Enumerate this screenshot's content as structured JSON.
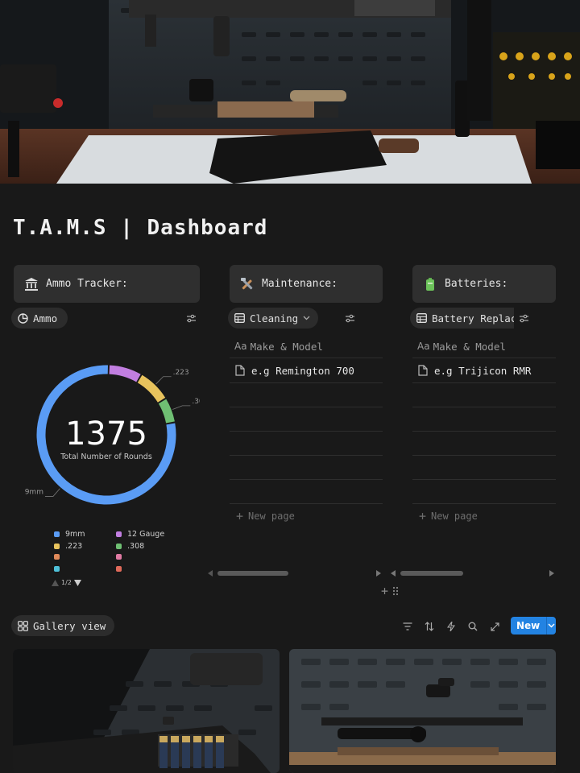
{
  "page": {
    "title": "T.A.M.S | Dashboard"
  },
  "callouts": {
    "ammo": "Ammo Tracker:",
    "maintenance": "Maintenance:",
    "batteries": "Batteries:"
  },
  "views": {
    "ammo_tab": "Ammo",
    "cleaning_tab": "Cleaning",
    "battery_tab": "Battery Replacement",
    "gallery_tab": "Gallery view"
  },
  "maintenance_table": {
    "column": "Make & Model",
    "rows": [
      "e.g Remington 700"
    ],
    "new_page": "New page"
  },
  "battery_table": {
    "column": "Make & Model",
    "rows": [
      "e.g Trijicon RMR"
    ],
    "new_page": "New page"
  },
  "chart_data": {
    "type": "pie",
    "total": "1375",
    "total_label": "Total Number of Rounds",
    "slice_labels": [
      ".308",
      ".223",
      "9mm"
    ],
    "series": [
      {
        "name": "9mm",
        "value": 1000,
        "color": "#5a9cf5"
      },
      {
        "name": "12 Gauge",
        "value": 100,
        "color": "#c17ee0"
      },
      {
        "name": ".223",
        "value": 100,
        "color": "#e8c35d"
      },
      {
        "name": ".308",
        "value": 75,
        "color": "#6fbf73"
      }
    ],
    "legend": {
      "items": [
        {
          "name": "9mm",
          "color": "#5a9cf5"
        },
        {
          "name": "12 Gauge",
          "color": "#c17ee0"
        },
        {
          "name": ".223",
          "color": "#e8c35d"
        },
        {
          "name": ".308",
          "color": "#6fbf73"
        },
        {
          "name": "",
          "color": "#e08a5a"
        },
        {
          "name": "",
          "color": "#e07aa3"
        },
        {
          "name": "",
          "color": "#4ec0d8"
        },
        {
          "name": "",
          "color": "#e06a5a"
        }
      ],
      "page": "1/2"
    }
  },
  "toolbar": {
    "new_label": "New"
  },
  "icons": {
    "ammo_callout": "bank-icon",
    "maintenance_callout": "tools-icon",
    "batteries_callout": "battery-icon"
  }
}
